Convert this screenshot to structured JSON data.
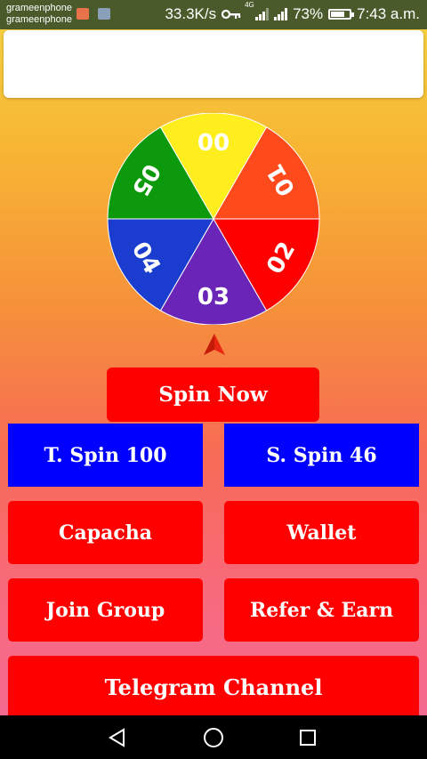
{
  "status_bar": {
    "carrier_1": "grameenphone",
    "carrier_2": "grameenphone",
    "speed": "33.3K/s",
    "network_label": "4G",
    "battery": "73%",
    "battery_level": 0.73,
    "time": "7:43 a.m.",
    "icons": [
      "app-notification-icon",
      "gallery-notification-icon",
      "vpn-key-icon",
      "signal-icon",
      "battery-icon"
    ]
  },
  "wheel": {
    "segments": [
      {
        "label": "00",
        "color": "#ffee1e"
      },
      {
        "label": "01",
        "color": "#ff4a1c"
      },
      {
        "label": "02",
        "color": "#ff0000"
      },
      {
        "label": "03",
        "color": "#6a25b8"
      },
      {
        "label": "04",
        "color": "#1a3dcf"
      },
      {
        "label": "05",
        "color": "#0c9a0c"
      }
    ]
  },
  "buttons": {
    "spin_now": "Spin Now",
    "total_spin": "T. Spin 100",
    "spin_left": "S. Spin 46",
    "capacha": "Capacha",
    "wallet": "Wallet",
    "join_group": "Join Group",
    "refer_earn": "Refer & Earn",
    "telegram": "Telegram Channel"
  },
  "colors": {
    "button_red": "#ff0000",
    "button_blue": "#0000ff",
    "pointer": "#e82612"
  }
}
